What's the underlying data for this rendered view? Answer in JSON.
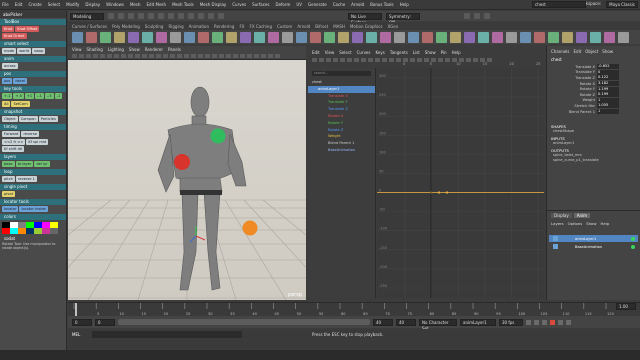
{
  "menubar": {
    "items": [
      "File",
      "Edit",
      "Create",
      "Select",
      "Modify",
      "Display",
      "Windows",
      "Mesh",
      "Edit Mesh",
      "Mesh Tools",
      "Mesh Display",
      "Curves",
      "Surfaces",
      "Deform",
      "UV",
      "Generate",
      "Cache",
      "Arnold",
      "Bonus Tools",
      "Help"
    ],
    "workspace_label": "Workspace:",
    "workspace_value": "Maya Classic",
    "search_value": "chest"
  },
  "statusline": {
    "menuset": "Modeling",
    "live_surface": "No Live Surface",
    "symmetry": "Symmetry: Off"
  },
  "shelf": {
    "tabs": [
      "Curves / Surfaces",
      "Poly Modeling",
      "Sculpting",
      "Rigging",
      "Animation",
      "Rendering",
      "FX",
      "FX Caching",
      "Custom",
      "Arnold",
      "Bifrost",
      "MASH",
      "Motion Graphics",
      "XGen"
    ]
  },
  "left_panel": {
    "title": "abxPicker",
    "header_tools": "ToolBox",
    "row_keys": [
      "Knot",
      "Knot Offset",
      "Knot Orient"
    ],
    "header_sel": "smart select",
    "row_sel": [
      "mode",
      "world",
      "swap"
    ],
    "header_anim": "anim",
    "row_anim": [
      "across"
    ],
    "header_pos": "pos",
    "row_pos": [
      "pos",
      "decel"
    ],
    "header_tween": "key tools",
    "row_nums": [
      "+.1",
      "+.5",
      "+1",
      "-.1",
      "-.5",
      "-1"
    ],
    "row_set": [
      "All",
      "SetCam"
    ],
    "header_snap": "snapshot",
    "row_snap": [
      "Object",
      "Compon",
      "Particles"
    ],
    "header_timing": "timing",
    "row_timing": [
      "Forward",
      "reverse"
    ],
    "row_kf": [
      "<<2 fr >>",
      "Kf spl mid",
      "Kf shift dtl"
    ],
    "header_layers": "layers",
    "row_layers": [
      "base",
      "to layer",
      "del lyr"
    ],
    "header_loop": "loop",
    "row_loop": [
      "pitch",
      "reverse 1"
    ],
    "header_pivot": "single pivot",
    "row_pivot": [
      "pivot"
    ],
    "header_locator": "locator tools",
    "row_locator": [
      "locator",
      "locator inside"
    ],
    "header_color": "colors",
    "palette": [
      "#000000",
      "#ffffff",
      "#7f7f7f",
      "#00ff00",
      "#0000ff",
      "#ff00ff",
      "#ffff00",
      "#ff0000",
      "#00ffff",
      "#ff8800",
      "#003366",
      "#99cc33",
      "#cc3399",
      "#666666"
    ],
    "footer_label": "sodat",
    "status_text": "Rotate Tool: Use manipulator to rotate object(s)."
  },
  "viewport": {
    "menus": [
      "View",
      "Shading",
      "Lighting",
      "Show",
      "Renderer",
      "Panels"
    ],
    "camera_label": "persp"
  },
  "graph_editor": {
    "menus": [
      "Edit",
      "View",
      "Select",
      "Curves",
      "Keys",
      "Tangents",
      "List",
      "Show",
      "Pin",
      "Help"
    ],
    "search_placeholder": "search...",
    "outliner": [
      {
        "label": "chest",
        "sel": false
      },
      {
        "label": "animLayer1",
        "sel": true
      },
      {
        "label": "Translate X",
        "sel": false
      },
      {
        "label": "Translate Y",
        "sel": false
      },
      {
        "label": "Translate Z",
        "sel": false
      },
      {
        "label": "Rotate X",
        "sel": false
      },
      {
        "label": "Rotate Y",
        "sel": false
      },
      {
        "label": "Rotate Z",
        "sel": false
      },
      {
        "label": "Weight",
        "sel": false
      },
      {
        "label": "Blend Parent 1",
        "sel": false
      },
      {
        "label": "BaseAnimation",
        "sel": false
      }
    ],
    "y_ticks": [
      "300",
      "250",
      "200",
      "150",
      "100",
      "50",
      "0",
      "-50",
      "-100",
      "-150",
      "-200",
      "-250"
    ],
    "x_ticks": [
      "0",
      "5",
      "10",
      "15",
      "20",
      "25"
    ]
  },
  "channel_box": {
    "menus": [
      "Channels",
      "Edit",
      "Object",
      "Show"
    ],
    "object": "chest",
    "channels": [
      {
        "name": "Translate X",
        "value": "-0.652"
      },
      {
        "name": "Translate Y",
        "value": "0"
      },
      {
        "name": "Translate Z",
        "value": "0.122"
      },
      {
        "name": "Rotate X",
        "value": "3.182"
      },
      {
        "name": "Rotate Y",
        "value": "1.199"
      },
      {
        "name": "Rotate Z",
        "value": "0.199"
      },
      {
        "name": "Weight",
        "value": "1"
      },
      {
        "name": "Stretch Hbr",
        "value": "1.055"
      },
      {
        "name": "Blend Parent 1",
        "value": "1"
      }
    ],
    "shapes_header": "SHAPES",
    "shapes": [
      "chestShape"
    ],
    "inputs_header": "INPUTS",
    "inputs": [
      "animLayer1"
    ],
    "outputs_header": "OUTPUTS",
    "outputs": [
      "spine_twist_mm",
      "spine_curve_p1_translate"
    ]
  },
  "layer_editor": {
    "tabs": [
      "Display",
      "Anim"
    ],
    "menus": [
      "Layers",
      "Options",
      "Show",
      "Help"
    ],
    "layers": [
      {
        "name": "animLayer1",
        "sel": true
      },
      {
        "name": "BaseAnimation",
        "sel": false
      }
    ]
  },
  "timeline": {
    "ticks": [
      "0",
      "5",
      "10",
      "15",
      "20",
      "25",
      "30",
      "35",
      "40",
      "45",
      "50",
      "55",
      "60",
      "65",
      "70",
      "75",
      "80",
      "85",
      "90",
      "95",
      "100",
      "105",
      "110",
      "115",
      "120"
    ],
    "current": "1.00"
  },
  "range": {
    "start": "0",
    "start2": "0",
    "end2": "40",
    "end": "40",
    "character_set": "No Character Set",
    "anim_layer": "animLayer1",
    "fps": "30 fps"
  },
  "cmdline": {
    "label": "MEL",
    "help": "Press the ESC key to stop playback."
  }
}
